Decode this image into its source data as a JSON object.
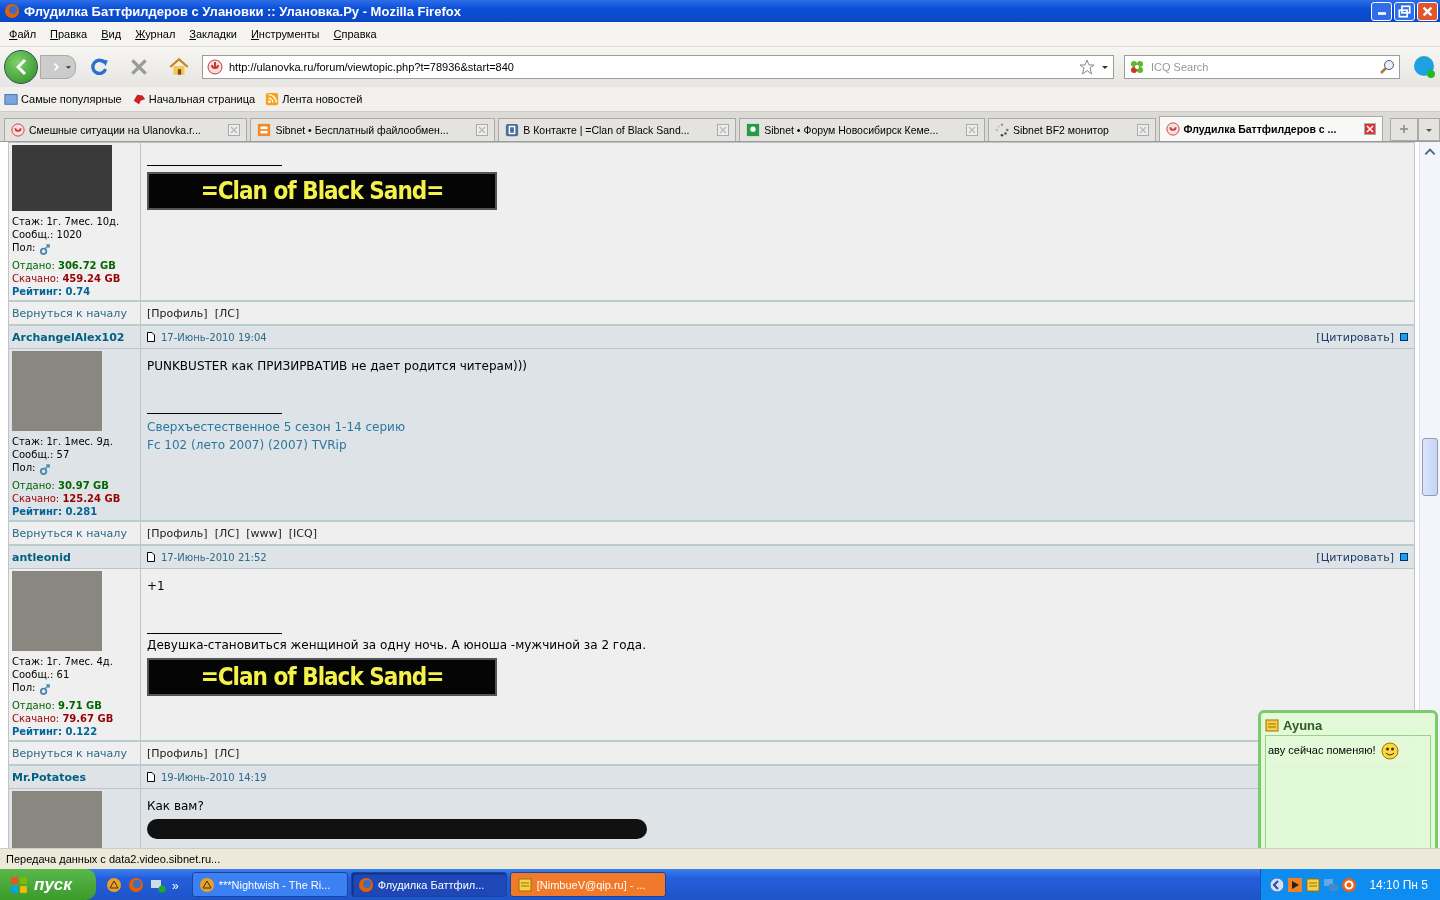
{
  "window": {
    "title": "Флудилка Баттфилдеров с Улановки :: Улановка.Ру - Mozilla Firefox"
  },
  "menu": [
    "Файл",
    "Правка",
    "Вид",
    "Журнал",
    "Закладки",
    "Инструменты",
    "Справка"
  ],
  "navigation": {
    "url": "http://ulanovka.ru/forum/viewtopic.php?t=78936&start=840",
    "search_placeholder": "ICQ Search"
  },
  "bookmarks": [
    {
      "label": "Самые популярные",
      "kind": "folder"
    },
    {
      "label": "Начальная страница",
      "kind": "dog"
    },
    {
      "label": "Лента новостей",
      "kind": "feed"
    }
  ],
  "tabs": [
    {
      "label": "Смешные ситуации на Ulanovka.r...",
      "kind": "site",
      "selected": false
    },
    {
      "label": "Sibnet • Бесплатный файлообмен...",
      "kind": "sibnet",
      "selected": false
    },
    {
      "label": "В Контакте | =Clan of Black Sand...",
      "kind": "vk",
      "selected": false
    },
    {
      "label": "Sibnet • Форум Новосибирск Кеме...",
      "kind": "forum",
      "selected": false
    },
    {
      "label": "Sibnet BF2 монитор",
      "kind": "loading",
      "selected": false
    },
    {
      "label": "Флудилка Баттфилдеров с ...",
      "kind": "site",
      "selected": true
    }
  ],
  "posts": [
    {
      "stats": [
        {
          "kind": "plain",
          "label": "Стаж:",
          "value": "1г. 7мес. 10д."
        },
        {
          "kind": "plain",
          "label": "Сообщ.:",
          "value": "1020"
        },
        {
          "kind": "gender",
          "label": "Пол:"
        },
        {
          "kind": "up",
          "label": "Отдано:",
          "value": "306.72 GB"
        },
        {
          "kind": "down",
          "label": "Скачано:",
          "value": "459.24 GB"
        },
        {
          "kind": "rating",
          "label": "Рейтинг:",
          "value": "0.74"
        }
      ],
      "body": [
        {
          "kind": "rule"
        },
        {
          "kind": "banner",
          "text": "=Clan of Black Sand="
        }
      ],
      "back": "Вернуться к началу",
      "links": [
        "[Профиль]",
        "[ЛС]"
      ]
    },
    {
      "author": "ArchangelAlex102",
      "date": "17-Июнь-2010 19:04",
      "quote": "[Цитировать]",
      "stats": [
        {
          "kind": "plain",
          "label": "Стаж:",
          "value": "1г. 1мес. 9д."
        },
        {
          "kind": "plain",
          "label": "Сообщ.:",
          "value": "57"
        },
        {
          "kind": "gender",
          "label": "Пол:"
        },
        {
          "kind": "up",
          "label": "Отдано:",
          "value": "30.97 GB"
        },
        {
          "kind": "down",
          "label": "Скачано:",
          "value": "125.24 GB"
        },
        {
          "kind": "rating",
          "label": "Рейтинг:",
          "value": "0.281"
        }
      ],
      "body": [
        {
          "kind": "text",
          "text": "PUNKBUSTER как ПРИЗИРВАТИВ не дает родится читерам)))"
        },
        {
          "kind": "gap"
        },
        {
          "kind": "rule"
        },
        {
          "kind": "link",
          "text": "Сверхъестественное 5 сезон 1-14 серию"
        },
        {
          "kind": "link",
          "text": "Fc 102 (лето 2007) (2007) TVRip"
        }
      ],
      "back": "Вернуться к началу",
      "links": [
        "[Профиль]",
        "[ЛС]",
        "[www]",
        "[ICQ]"
      ]
    },
    {
      "author": "antleonid",
      "date": "17-Июнь-2010 21:52",
      "quote": "[Цитировать]",
      "stats": [
        {
          "kind": "plain",
          "label": "Стаж:",
          "value": "1г. 7мес. 4д."
        },
        {
          "kind": "plain",
          "label": "Сообщ.:",
          "value": "61"
        },
        {
          "kind": "gender",
          "label": "Пол:"
        },
        {
          "kind": "up",
          "label": "Отдано:",
          "value": "9.71 GB"
        },
        {
          "kind": "down",
          "label": "Скачано:",
          "value": "79.67 GB"
        },
        {
          "kind": "rating",
          "label": "Рейтинг:",
          "value": "0.122"
        }
      ],
      "body": [
        {
          "kind": "text",
          "text": "+1"
        },
        {
          "kind": "gap"
        },
        {
          "kind": "rule"
        },
        {
          "kind": "text",
          "text": "Девушка-становиться женщиной за одну ночь. А юноша -мужчиной за 2 года."
        },
        {
          "kind": "banner",
          "text": "=Clan of Black Sand="
        }
      ],
      "back": "Вернуться к началу",
      "links": [
        "[Профиль]",
        "[ЛС]"
      ]
    },
    {
      "author": "Mr.Potatoes",
      "date": "19-Июнь-2010 14:19",
      "body": [
        {
          "kind": "text",
          "text": "Как вам?"
        },
        {
          "kind": "video"
        }
      ]
    }
  ],
  "status_bar": "Передача данных с data2.video.sibnet.ru...",
  "taskbar": {
    "start": "пуск",
    "more": "»",
    "tasks": [
      {
        "label": "***Nightwish - The Ri...",
        "kind": "player",
        "selected": false,
        "flashing": false
      },
      {
        "label": "Флудилка Баттфил...",
        "kind": "browser",
        "selected": true,
        "flashing": false
      },
      {
        "label": "[NimbueV@qip.ru] - ...",
        "kind": "chat",
        "selected": false,
        "flashing": true
      }
    ],
    "clock": "14:10 Пн 5"
  },
  "popup": {
    "name": "Ayuna",
    "message": "аву сейчас поменяю!"
  }
}
